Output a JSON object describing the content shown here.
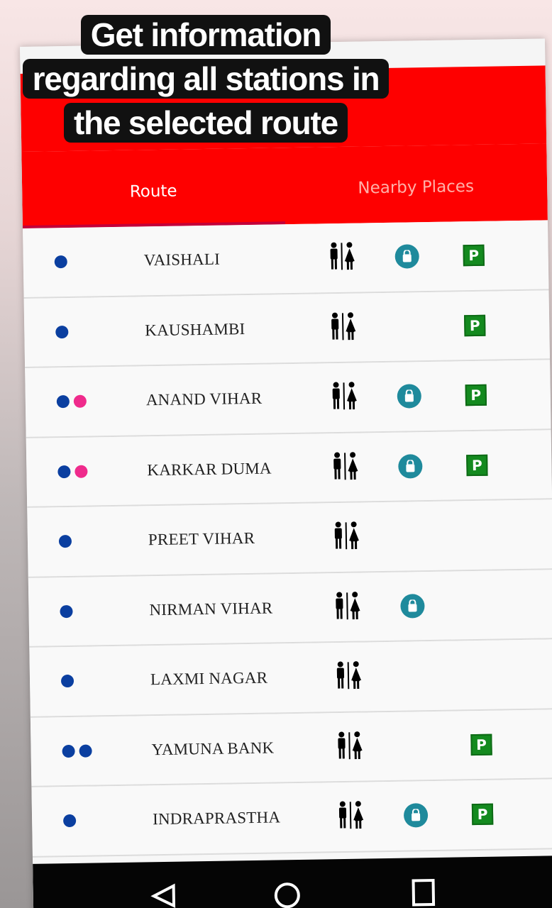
{
  "caption": {
    "line1": "Get information",
    "line2": "regarding all stations in",
    "line3": "the selected route"
  },
  "tabs": [
    {
      "label": "Route",
      "active": true
    },
    {
      "label": "Nearby Places",
      "active": false
    }
  ],
  "colors": {
    "app_bar": "#fe0000",
    "tab_indicator": "#c2003a",
    "blue_line": "#0b3fa0",
    "pink_line": "#ef2b8c",
    "parking": "#148a1f",
    "shopping": "#1f8a9c"
  },
  "icons": {
    "toilet": "toilet-icon",
    "shopping": "shopping-bag-icon",
    "parking": "parking-icon",
    "parking_letter": "P"
  },
  "stations": [
    {
      "name": "VAISHALI",
      "lines": [
        "#0b3fa0"
      ],
      "toilet": true,
      "shopping": true,
      "parking": true
    },
    {
      "name": "KAUSHAMBI",
      "lines": [
        "#0b3fa0"
      ],
      "toilet": true,
      "shopping": false,
      "parking": true
    },
    {
      "name": "ANAND VIHAR",
      "lines": [
        "#0b3fa0",
        "#ef2b8c"
      ],
      "toilet": true,
      "shopping": true,
      "parking": true
    },
    {
      "name": "KARKAR DUMA",
      "lines": [
        "#0b3fa0",
        "#ef2b8c"
      ],
      "toilet": true,
      "shopping": true,
      "parking": true
    },
    {
      "name": "PREET VIHAR",
      "lines": [
        "#0b3fa0"
      ],
      "toilet": true,
      "shopping": false,
      "parking": false
    },
    {
      "name": "NIRMAN VIHAR",
      "lines": [
        "#0b3fa0"
      ],
      "toilet": true,
      "shopping": true,
      "parking": false
    },
    {
      "name": "LAXMI NAGAR",
      "lines": [
        "#0b3fa0"
      ],
      "toilet": true,
      "shopping": false,
      "parking": false
    },
    {
      "name": "YAMUNA BANK",
      "lines": [
        "#0b3fa0",
        "#0b3fa0"
      ],
      "toilet": true,
      "shopping": false,
      "parking": true
    },
    {
      "name": "INDRAPRASTHA",
      "lines": [
        "#0b3fa0"
      ],
      "toilet": true,
      "shopping": true,
      "parking": true
    }
  ]
}
